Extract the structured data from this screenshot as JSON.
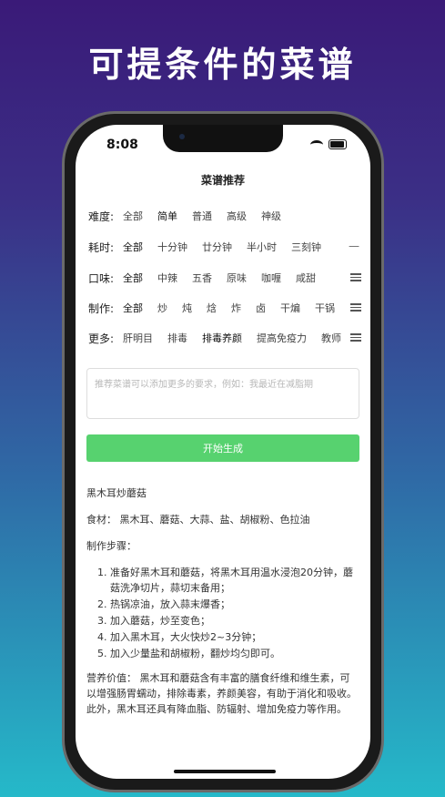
{
  "headline": "可提条件的菜谱",
  "status_bar": {
    "time": "8:08"
  },
  "nav": {
    "title": "菜谱推荐"
  },
  "filters": [
    {
      "label": "难度:",
      "options": [
        "全部",
        "简单",
        "普通",
        "高级",
        "神级"
      ],
      "selected": 1
    },
    {
      "label": "耗时:",
      "options": [
        "全部",
        "十分钟",
        "廿分钟",
        "半小时",
        "三刻钟"
      ],
      "selected": 0
    },
    {
      "label": "口味:",
      "options": [
        "全部",
        "中辣",
        "五香",
        "原味",
        "咖喱",
        "咸甜"
      ],
      "selected": 0
    },
    {
      "label": "制作:",
      "options": [
        "全部",
        "炒",
        "炖",
        "焓",
        "炸",
        "卤",
        "干煸",
        "干锅"
      ],
      "selected": 0
    },
    {
      "label": "更多:",
      "options": [
        "肝明目",
        "排毒",
        "排毒养颜",
        "提高免疫力",
        "教师"
      ],
      "selected": 2
    }
  ],
  "request_input": {
    "placeholder": "推荐菜谱可以添加更多的要求，例如：我最近在减脂期"
  },
  "generate_button": {
    "label": "开始生成"
  },
  "recipe": {
    "name": "黑木耳炒蘑菇",
    "ingredients": "食材： 黑木耳、蘑菇、大蒜、盐、胡椒粉、色拉油",
    "steps_title": "制作步骤：",
    "steps": [
      "准备好黑木耳和蘑菇，将黑木耳用温水浸泡20分钟，蘑菇洗净切片，蒜切末备用；",
      "热锅凉油，放入蒜末爆香；",
      "加入蘑菇，炒至变色；",
      "加入黑木耳，大火快炒2~3分钟；",
      "加入少量盐和胡椒粉，翻炒均匀即可。"
    ],
    "nutrition": "营养价值： 黑木耳和蘑菇含有丰富的膳食纤维和维生素，可以增强肠胃蠕动，排除毒素，养颜美容，有助于消化和吸收。此外，黑木耳还具有降血脂、防辐射、增加免疫力等作用。"
  }
}
